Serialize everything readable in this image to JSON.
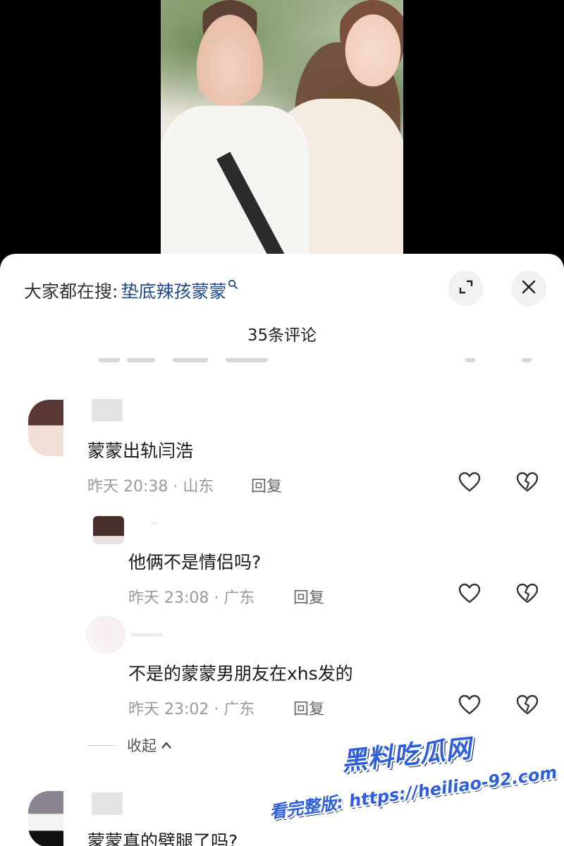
{
  "search": {
    "prefix": "大家都在搜:",
    "term": "垫底辣孩蒙蒙"
  },
  "comments_header": {
    "count_label": "35条评论"
  },
  "comments": [
    {
      "text": "蒙蒙出轨闫浩",
      "meta": "昨天 20:38 · 山东",
      "reply_label": "回复"
    },
    {
      "text": "他俩不是情侣吗?",
      "meta": "昨天 23:08 · 广东",
      "reply_label": "回复"
    },
    {
      "text": "不是的蒙蒙男朋友在xhs发的",
      "meta": "昨天 23:02 · 广东",
      "reply_label": "回复"
    },
    {
      "text": "蒙蒙真的劈腿了吗?"
    }
  ],
  "collapse": {
    "label": "收起"
  },
  "watermark": {
    "title": "黑料吃瓜网",
    "line": "看完整版: https://heiliao-92.com"
  },
  "icons": {
    "expand": "expand-icon",
    "close": "close-icon",
    "like": "heart-outline-icon",
    "dislike": "broken-heart-icon",
    "search": "search-icon"
  },
  "colors": {
    "search_term": "#1f4a8a",
    "watermark": "#2e5fd9"
  }
}
